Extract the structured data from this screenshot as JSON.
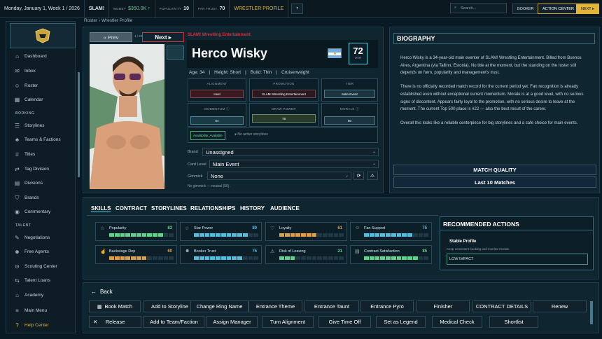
{
  "topbar": {
    "date": "Monday, January 1, Week 1 / 2026",
    "company": "SLAM!",
    "money_label": "MONEY",
    "money": "$350.0K",
    "money_arrow": "↑",
    "popularity_label": "POPULARITY",
    "popularity": "10",
    "fan_trust_label": "FAN TRUST",
    "fan_trust": "70",
    "screen": "WRESTLER PROFILE",
    "help": "?",
    "search_placeholder": "Search...",
    "booker": "BOOKER",
    "action_center": "ACTION CENTER",
    "next": "NEXT ▸"
  },
  "sidebar": {
    "items": [
      {
        "label": "Dashboard",
        "icon": "home-icon"
      },
      {
        "label": "Inbox",
        "icon": "inbox-icon"
      },
      {
        "label": "Roster",
        "icon": "roster-icon"
      },
      {
        "label": "Calendar",
        "icon": "calendar-icon"
      }
    ],
    "booking_header": "BOOKING",
    "booking": [
      {
        "label": "Storylines"
      },
      {
        "label": "Teams & Factions"
      },
      {
        "label": "Titles"
      },
      {
        "label": "Tag Division"
      },
      {
        "label": "Divisions"
      },
      {
        "label": "Brands"
      },
      {
        "label": "Commentary"
      }
    ],
    "talent_header": "TALENT",
    "talent": [
      {
        "label": "Negotiations"
      },
      {
        "label": "Free Agents"
      },
      {
        "label": "Scouting Center"
      },
      {
        "label": "Talent Loans"
      },
      {
        "label": "Academy"
      },
      {
        "label": "Main Menu"
      }
    ],
    "help": "Help Center"
  },
  "breadcrumb": {
    "root": "Roster",
    "sep": "›",
    "current": "Wrestler Profile"
  },
  "profile": {
    "prev": "« Prev",
    "page": "1 / 20",
    "next": "Next ▸",
    "company": "SLAM! Wrestling Entertainment",
    "name": "Herco Wisky",
    "ovr": "72",
    "ovr_label": "OVR",
    "age": "Age: 34",
    "height": "Height: Short",
    "build": "Build: Thin",
    "weight": "Cruiserweight",
    "alignment_label": "ALIGNMENT",
    "alignment": "Heel",
    "promotion_label": "PROMOTION",
    "promotion": "SLAM! Wrestling Entertainment",
    "tier_label": "TIER",
    "tier": "Main Event",
    "momentum_label": "MOMENTUM",
    "momentum": "64",
    "draw_label": "DRAW POWER",
    "draw": "78",
    "morale_label": "MORALE",
    "morale": "80",
    "availability": "Availability: Available",
    "storylines": "No active storylines",
    "brand_label": "Brand",
    "brand": "Unassigned",
    "card_label": "Card Level",
    "card": "Main Event",
    "gimmick_label": "Gimmick",
    "gimmick": "None",
    "gimmick_note": "No gimmick — neutral (50)."
  },
  "bio": {
    "header": "BIOGRAPHY",
    "p1": "Herco Wisky is a 34-year-old main eventer of SLAM! Wrestling Entertainment. Billed from Buenos Aires, Argentina (via Tallinn, Estonia). No title at the moment, but the standing on the roster still depends on form, popularity and management's trust.",
    "p2": "There is no officially recorded match record for the current period yet. Fan recognition is already established even without exceptional current momentum. Morale is at a good level, with no serious signs of discontent. Appears fairly loyal to the promotion, with no serious desire to leave at the moment. The current Top 500 place is #22 — also the best result of the career.",
    "p3": "Overall this looks like a reliable centerpiece for big storylines and a safe choice for main events.",
    "match_quality": "MATCH QUALITY",
    "last10": "Last 10 Matches"
  },
  "tabs": [
    "SKILLS",
    "CONTRACT",
    "STORYLINES",
    "RELATIONSHIPS",
    "HISTORY",
    "AUDIENCE"
  ],
  "stats": [
    {
      "name": "Popularity",
      "value": 83,
      "color": "#5fd38a"
    },
    {
      "name": "Star Power",
      "value": 80,
      "color": "#4fc0e0"
    },
    {
      "name": "Loyalty",
      "value": 61,
      "color": "#e0a040"
    },
    {
      "name": "Fan Support",
      "value": 75,
      "color": "#4fc0e0"
    },
    {
      "name": "Backstage Rep",
      "value": 60,
      "color": "#e0a040"
    },
    {
      "name": "Booker Trust",
      "value": 75,
      "color": "#4fc0e0"
    },
    {
      "name": "Risk of Leaving",
      "value": 21,
      "color": "#5fd38a"
    },
    {
      "name": "Contract Satisfaction",
      "value": 85,
      "color": "#5fd38a"
    }
  ],
  "recommended": {
    "header": "RECOMMENDED ACTIONS",
    "title": "Stable Profile",
    "desc": "Keep consistent booking and monitor morale.",
    "impact": "LOW IMPACT"
  },
  "actions": {
    "back": "Back",
    "row1": [
      "Book Match",
      "Add to Storyline",
      "Change Ring Name",
      "Entrance Theme",
      "Entrance Taunt",
      "Entrance Pyro",
      "Finisher",
      "CONTRACT DETAILS",
      "Renew"
    ],
    "row2": [
      "Release",
      "Add to Team/Faction",
      "Assign Manager",
      "Turn Alignment",
      "Give Time Off",
      "Set as Legend",
      "Medical Check",
      "Shortlist"
    ]
  }
}
